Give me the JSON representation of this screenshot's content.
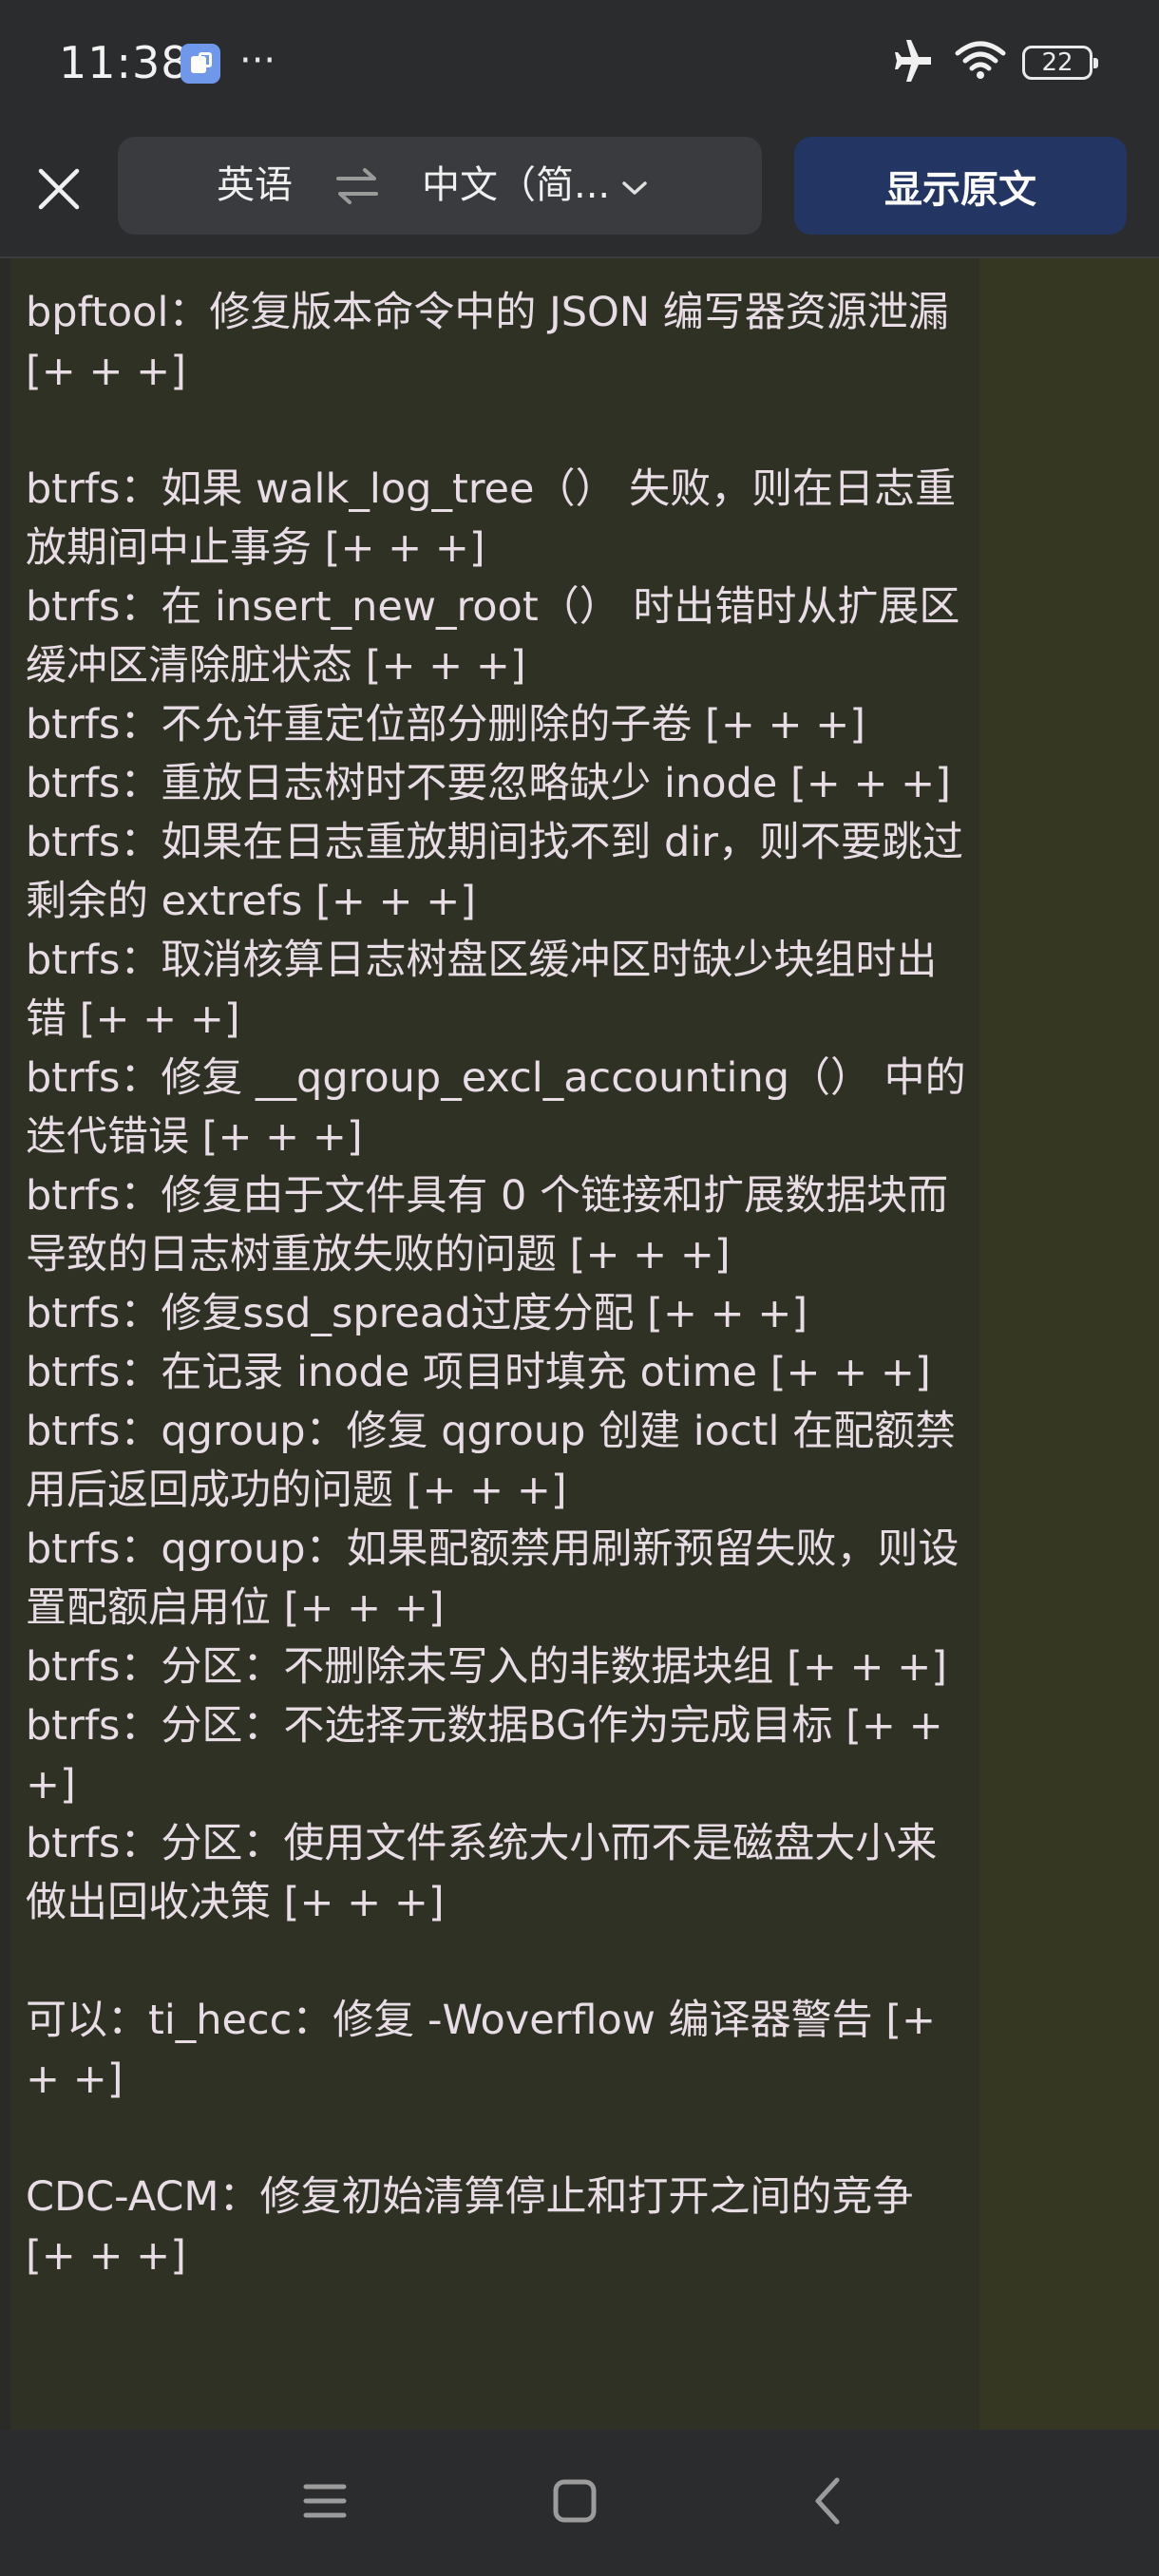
{
  "status_bar": {
    "time": "11:38",
    "more": "···",
    "battery_level": "22",
    "icons": [
      "app-notification-icon",
      "airplane-mode-icon",
      "wifi-icon",
      "battery-icon"
    ]
  },
  "toolbar": {
    "close_icon": "close-icon",
    "source_language": "英语",
    "swap_icon": "swap-arrows-icon",
    "target_language": "中文（简...",
    "dropdown_icon": "chevron-down-icon",
    "show_original_label": "显示原文"
  },
  "content": {
    "entries": [
      {
        "text": "bpftool：修复版本命令中的 JSON 编写器资源泄漏 [+ + +]",
        "gap_before": false
      },
      {
        "text": "btrfs：如果 walk_log_tree（） 失败，则在日志重放期间中止事务 [+ + +]",
        "gap_before": true
      },
      {
        "text": "btrfs：在 insert_new_root（） 时出错时从扩展区缓冲区清除脏状态 [+ + +]",
        "gap_before": false
      },
      {
        "text": "btrfs：不允许重定位部分删除的子卷 [+ + +]",
        "gap_before": false
      },
      {
        "text": "btrfs：重放日志树时不要忽略缺少 inode [+ + +]",
        "gap_before": false
      },
      {
        "text": "btrfs：如果在日志重放期间找不到 dir，则不要跳过剩余的 extrefs [+ + +]",
        "gap_before": false
      },
      {
        "text": "btrfs：取消核算日志树盘区缓冲区时缺少块组时出错 [+ + +]",
        "gap_before": false
      },
      {
        "text": "btrfs：修复 __qgroup_excl_accounting（） 中的迭代错误 [+ + +]",
        "gap_before": false
      },
      {
        "text": "btrfs：修复由于文件具有 0 个链接和扩展数据块而导致的日志树重放失败的问题 [+ + +]",
        "gap_before": false
      },
      {
        "text": "btrfs：修复ssd_spread过度分配 [+ + +]",
        "gap_before": false
      },
      {
        "text": "btrfs：在记录 inode 项目时填充 otime [+ + +]",
        "gap_before": false
      },
      {
        "text": "btrfs：qgroup：修复 qgroup 创建 ioctl 在配额禁用后返回成功的问题 [+ + +]",
        "gap_before": false
      },
      {
        "text": "btrfs：qgroup：如果配额禁用刷新预留失败，则设置配额启用位 [+ + +]",
        "gap_before": false
      },
      {
        "text": "btrfs：分区：不删除未写入的非数据块组 [+ + +]",
        "gap_before": false
      },
      {
        "text": "btrfs：分区：不选择元数据BG作为完成目标 [+ + +]",
        "gap_before": false
      },
      {
        "text": "btrfs：分区：使用文件系统大小而不是磁盘大小来做出回收决策 [+ + +]",
        "gap_before": false
      },
      {
        "text": "可以：ti_hecc：修复 -Woverflow 编译器警告 [+ + +]",
        "gap_before": true
      },
      {
        "text": "CDC-ACM：修复初始清算停止和打开之间的竞争 [+ + +]",
        "gap_before": true
      }
    ]
  },
  "nav_bar": {
    "icons": [
      "menu-icon",
      "home-square-icon",
      "back-chevron-icon"
    ]
  },
  "colors": {
    "chrome_background": "#2b2c2e",
    "content_background": "#2f3125",
    "right_pane_background": "#353723",
    "text": "#e9dde5",
    "show_original_button": "#233563",
    "language_box": "#3a3b3e"
  }
}
